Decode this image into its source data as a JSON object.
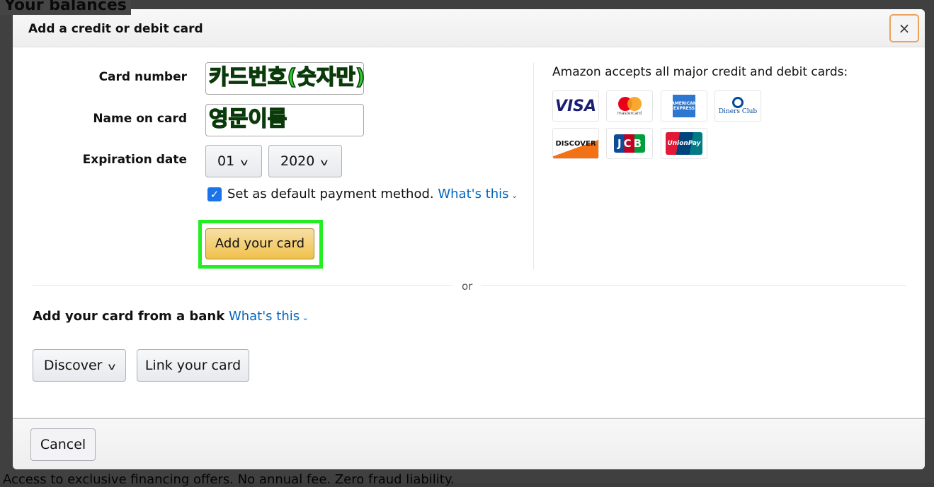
{
  "background": {
    "heading": "Your balances",
    "footer_text": "Access to exclusive financing offers. No annual fee. Zero fraud liability."
  },
  "modal": {
    "title": "Add a credit or debit card",
    "close_icon": "×",
    "form": {
      "card_number_label": "Card number",
      "card_number_annotation": "카드번호(숫자만)",
      "name_label": "Name on card",
      "name_annotation": "영문이름",
      "expiration_label": "Expiration date",
      "month": "01",
      "year": "2020",
      "default_checked": true,
      "default_label": "Set as default payment method.",
      "whats_this": "What's this",
      "add_button": "Add your card"
    },
    "accepts_text": "Amazon accepts all major credit and debit cards:",
    "card_logos": [
      "VISA",
      "mastercard",
      "American Express",
      "Diners Club",
      "DISCOVER",
      "JCB",
      "UnionPay"
    ],
    "or": "or",
    "bank": {
      "label": "Add your card from a bank",
      "whats_this": "What's this",
      "bank_select": "Discover",
      "link_button": "Link your card"
    },
    "cancel": "Cancel",
    "colors": {
      "annotation": "#2ecc2e",
      "link": "#0066c0",
      "add_button": "#f0c14b"
    }
  }
}
